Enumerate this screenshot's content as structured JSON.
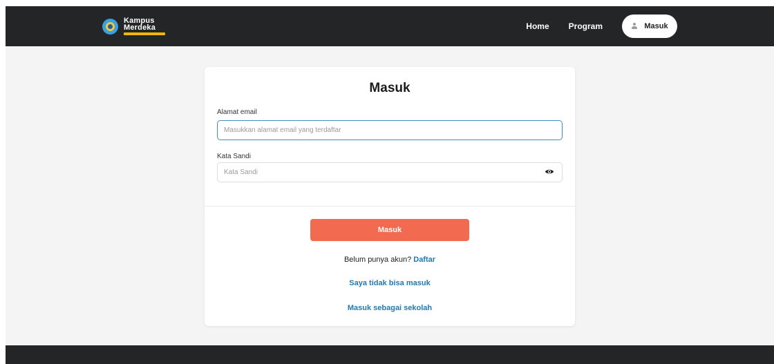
{
  "navbar": {
    "logo": {
      "line1": "Kampus",
      "line2": "Merdeka",
      "icon": "tut-wuri-handayani-emblem"
    },
    "links": [
      "Home",
      "Program"
    ],
    "login_button": {
      "label": "Masuk",
      "icon": "user-icon"
    },
    "background": "#242526"
  },
  "login_card": {
    "title": "Masuk",
    "email": {
      "label": "Alamat email",
      "value": "",
      "placeholder": "Masukkan alamat email yang terdaftar"
    },
    "password": {
      "label": "Kata Sandi",
      "value": "",
      "placeholder": "Kata Sandi",
      "toggle_icon": "eye-icon"
    },
    "submit_label": "Masuk",
    "signup_prompt": "Belum punya akun?",
    "signup_link": "Daftar",
    "cant_login_link": "Saya tidak bisa masuk",
    "school_login_link": "Masuk sebagai sekolah"
  },
  "colors": {
    "accent": "#f26b51",
    "link": "#1f7ab3",
    "focus_border": "#3a8fc9",
    "page_bg": "#f4f4f4"
  }
}
